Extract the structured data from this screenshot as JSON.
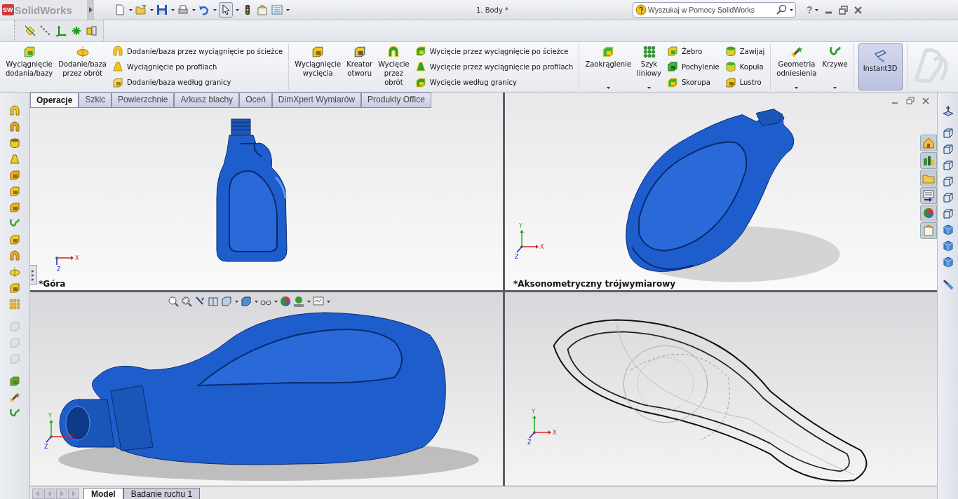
{
  "app": {
    "logo_mark": "SW",
    "logo": "SolidWorks",
    "document_title": "1. Body *",
    "help_search": {
      "placeholder": "Wyszukaj w Pomocy SolidWorks"
    },
    "help_button": "?"
  },
  "ribbon": {
    "groups": [
      {
        "items": [
          {
            "kind": "large",
            "label": "Wyciągnięcie\ndodania/bazy",
            "dropdown": false
          },
          {
            "kind": "large",
            "label": "Dodanie/baza\nprzez obrót",
            "dropdown": false
          },
          {
            "kind": "stack",
            "items": [
              {
                "label": "Dodanie/baza przez wyciągnięcie po ścieżce"
              },
              {
                "label": "Wyciągnięcie po profilach"
              },
              {
                "label": "Dodanie/baza według granicy"
              }
            ]
          }
        ]
      },
      {
        "items": [
          {
            "kind": "large",
            "label": "Wyciągnięcie\nwycięcia",
            "dropdown": false
          },
          {
            "kind": "large",
            "label": "Kreator\notworu",
            "dropdown": false
          },
          {
            "kind": "large",
            "label": "Wycięcie\nprzez\nobrót",
            "dropdown": false
          },
          {
            "kind": "stack",
            "items": [
              {
                "label": "Wycięcie przez wyciągnięcie po ścieżce"
              },
              {
                "label": "Wycięcie przez wyciągnięcie po profilach"
              },
              {
                "label": "Wycięcie według granicy"
              }
            ]
          }
        ]
      },
      {
        "items": [
          {
            "kind": "large",
            "label": "Zaokrąglenie",
            "dropdown": true
          },
          {
            "kind": "large",
            "label": "Szyk\nliniowy",
            "dropdown": true
          },
          {
            "kind": "stack",
            "items": [
              {
                "label": "Żebro"
              },
              {
                "label": "Pochylenie"
              },
              {
                "label": "Skorupa"
              }
            ]
          },
          {
            "kind": "stack",
            "items": [
              {
                "label": "Zawijaj"
              },
              {
                "label": "Kopuła"
              },
              {
                "label": "Lustro"
              }
            ]
          }
        ]
      },
      {
        "items": [
          {
            "kind": "large",
            "label": "Geometria\nodniesienia",
            "dropdown": true
          },
          {
            "kind": "large",
            "label": "Krzywe",
            "dropdown": true
          }
        ]
      },
      {
        "items": [
          {
            "kind": "toggle",
            "label": "Instant3D",
            "on": true
          }
        ]
      }
    ]
  },
  "tabs": [
    {
      "label": "Operacje",
      "selected": true
    },
    {
      "label": "Szkic",
      "selected": false
    },
    {
      "label": "Powierzchnie",
      "selected": false
    },
    {
      "label": "Arkusz blachy",
      "selected": false
    },
    {
      "label": "Oceń",
      "selected": false
    },
    {
      "label": "DimXpert Wymiarów",
      "selected": false
    },
    {
      "label": "Produkty Office",
      "selected": false
    }
  ],
  "viewports": [
    {
      "title": "*Góra",
      "triad": {
        "x": "X",
        "z": "Z"
      }
    },
    {
      "title": "*Aksonometryczny trójwymiarowy",
      "triad": {
        "x": "X",
        "y": "Y",
        "z": "Z"
      }
    },
    {
      "triad": {
        "x": "X",
        "y": "Y",
        "z": "Z"
      }
    },
    {
      "triad": {
        "x": "X",
        "y": "Y",
        "z": "Z"
      }
    }
  ],
  "bottom_tabs": [
    {
      "label": "Model",
      "selected": true
    },
    {
      "label": "Badanie ruchu 1",
      "selected": false
    }
  ]
}
